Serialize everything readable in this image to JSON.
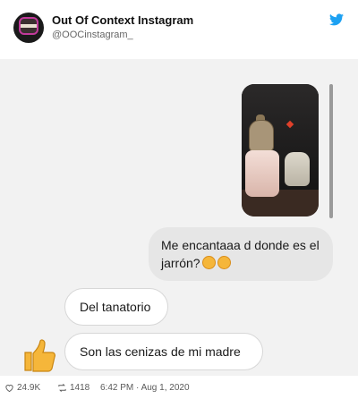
{
  "header": {
    "account_name": "Out Of Context Instagram",
    "handle": "@OOCinstagram_"
  },
  "conversation": {
    "sent_message": "Me encantaaa d donde es el jarrón?",
    "received_messages": [
      "Del tanatorio",
      "Son las cenizas de mi madre"
    ]
  },
  "footer": {
    "likes": "24.9K",
    "retweets": "1418",
    "timestamp": "6:42 PM · Aug 1, 2020"
  },
  "colors": {
    "twitter_blue": "#1da1f2",
    "chat_background": "#f2f2f2"
  },
  "icons": [
    "twitter-bird-icon",
    "heart-icon",
    "retweet-icon",
    "thumbs-up-emoji",
    "smiling-face-with-hearts-emoji"
  ]
}
